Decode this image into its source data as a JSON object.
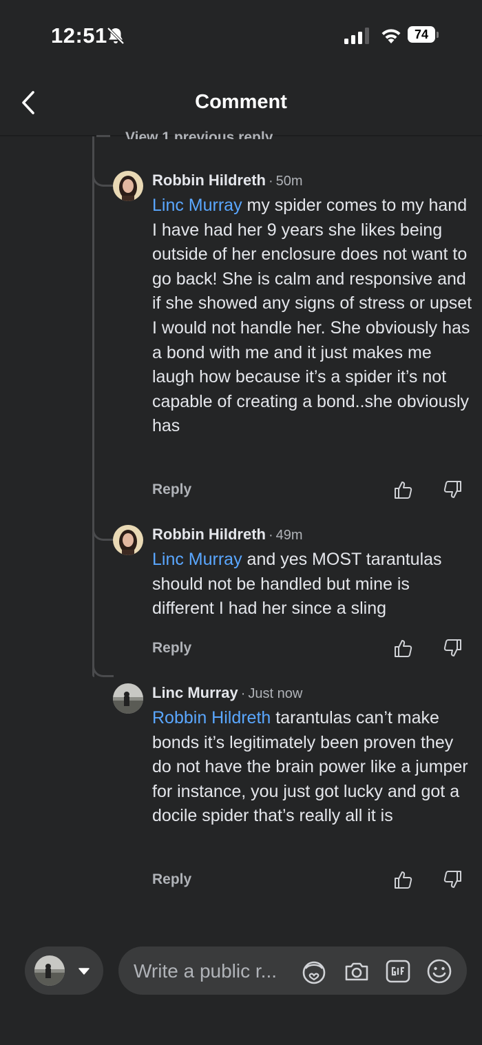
{
  "status_bar": {
    "time": "12:51",
    "battery": "74"
  },
  "header": {
    "title": "Comment"
  },
  "thread": {
    "previous_replies_link": "View 1 previous reply"
  },
  "comments": [
    {
      "author": "Robbin Hildreth",
      "separator": "·",
      "time": "50m",
      "mention": "Linc Murray",
      "text": " my spider comes to my hand I have had her 9 years she likes being outside of her enclosure does not want to go back!  She is calm and responsive and if she showed any signs of stress or upset I would not handle her.  She obviously has a bond with me and it just makes me laugh how because it’s a spider it’s not capable of creating a bond..she obviously has",
      "reply_label": "Reply"
    },
    {
      "author": "Robbin Hildreth",
      "separator": "·",
      "time": "49m",
      "mention": "Linc Murray",
      "text": " and yes MOST tarantulas should not be handled but mine is different I had her since a sling",
      "reply_label": "Reply"
    },
    {
      "author": "Linc Murray",
      "separator": "·",
      "time": "Just now",
      "mention": "Robbin Hildreth",
      "text": " tarantulas can’t make bonds it’s legitimately been proven they do not have the brain power like a jumper for instance, you just got lucky and got a docile spider that’s really all it is",
      "reply_label": "Reply"
    }
  ],
  "composer": {
    "placeholder": "Write a public r...",
    "icons": [
      "avatar-sticker-icon",
      "camera-icon",
      "gif-icon",
      "emoji-icon"
    ]
  },
  "colors": {
    "background": "#242526",
    "mention": "#5aa7ff",
    "secondary_text": "#b0b3b8",
    "pill": "#3a3b3c"
  }
}
